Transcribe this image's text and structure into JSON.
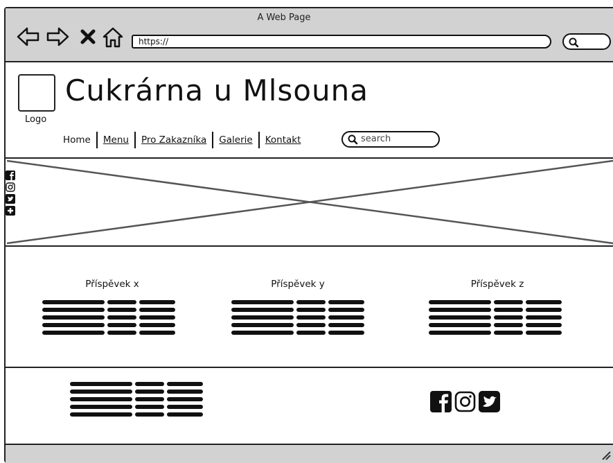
{
  "browser": {
    "title": "A Web Page",
    "url": "https://"
  },
  "site": {
    "logo_label": "Logo",
    "title": "Cukrárna u Mlsouna",
    "menu": [
      {
        "label": "Home",
        "underlined": false
      },
      {
        "label": "Menu",
        "underlined": true
      },
      {
        "label": "Pro Zakazníka",
        "underlined": true
      },
      {
        "label": "Galerie",
        "underlined": true
      },
      {
        "label": "Kontakt",
        "underlined": true
      }
    ],
    "search_placeholder": "search"
  },
  "posts": [
    {
      "title": "Příspěvek x"
    },
    {
      "title": "Příspěvek y"
    },
    {
      "title": "Příspěvek z"
    }
  ],
  "icons": {
    "left_social": [
      "facebook-icon",
      "instagram-icon",
      "twitter-icon",
      "plus-icon"
    ],
    "footer_social": [
      "facebook-icon",
      "instagram-icon",
      "twitter-icon"
    ]
  }
}
